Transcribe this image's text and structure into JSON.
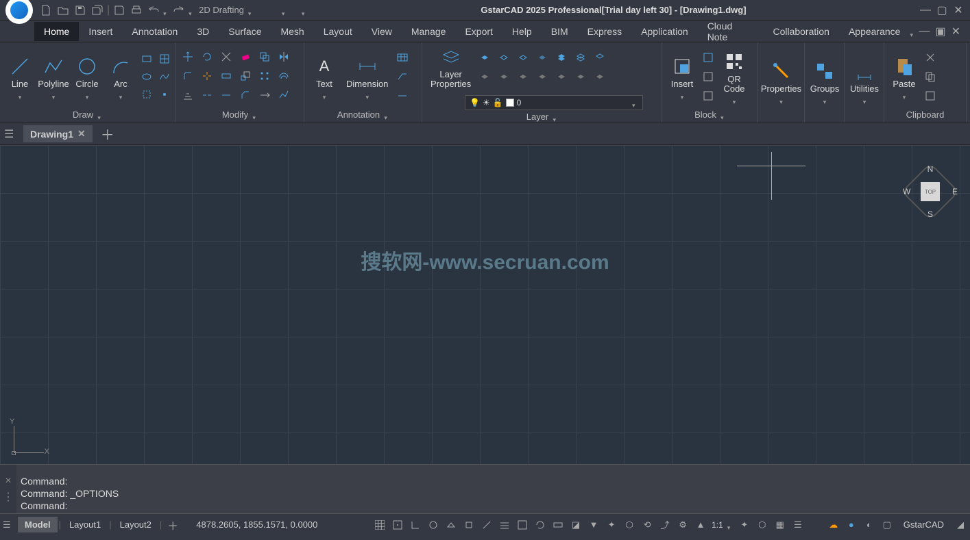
{
  "title": "GstarCAD 2025 Professional[Trial day left 30] - [Drawing1.dwg]",
  "workspace": "2D Drafting",
  "menus": [
    "Home",
    "Insert",
    "Annotation",
    "3D",
    "Surface",
    "Mesh",
    "Layout",
    "View",
    "Manage",
    "Export",
    "Help",
    "BIM",
    "Express",
    "Application",
    "Cloud Note",
    "Collaboration"
  ],
  "active_menu": "Home",
  "appearance_label": "Appearance",
  "ribbon": {
    "draw": {
      "title": "Draw",
      "line": "Line",
      "polyline": "Polyline",
      "circle": "Circle",
      "arc": "Arc"
    },
    "modify": {
      "title": "Modify"
    },
    "annotation": {
      "title": "Annotation",
      "text": "Text",
      "dimension": "Dimension"
    },
    "layer": {
      "title": "Layer",
      "props": "Layer\nProperties",
      "current": "0"
    },
    "block": {
      "title": "Block",
      "insert": "Insert",
      "qr": "QR\nCode"
    },
    "properties": {
      "title": "Properties"
    },
    "groups": {
      "title": "Groups"
    },
    "utilities": {
      "title": "Utilities"
    },
    "clipboard": {
      "title": "Clipboard",
      "paste": "Paste"
    }
  },
  "doc_tab": "Drawing1",
  "watermark": "搜软网-www.secruan.com",
  "navcube": {
    "top": "TOP",
    "n": "N",
    "s": "S",
    "e": "E",
    "w": "W"
  },
  "ucs": {
    "x": "X",
    "y": "Y"
  },
  "command_history": [
    "Command:",
    "Command: _OPTIONS",
    "Command:"
  ],
  "layout_tabs": [
    "Model",
    "Layout1",
    "Layout2"
  ],
  "active_layout": "Model",
  "coords": "4878.2605, 1855.1571, 0.0000",
  "scale": "1:1",
  "product": "GstarCAD"
}
